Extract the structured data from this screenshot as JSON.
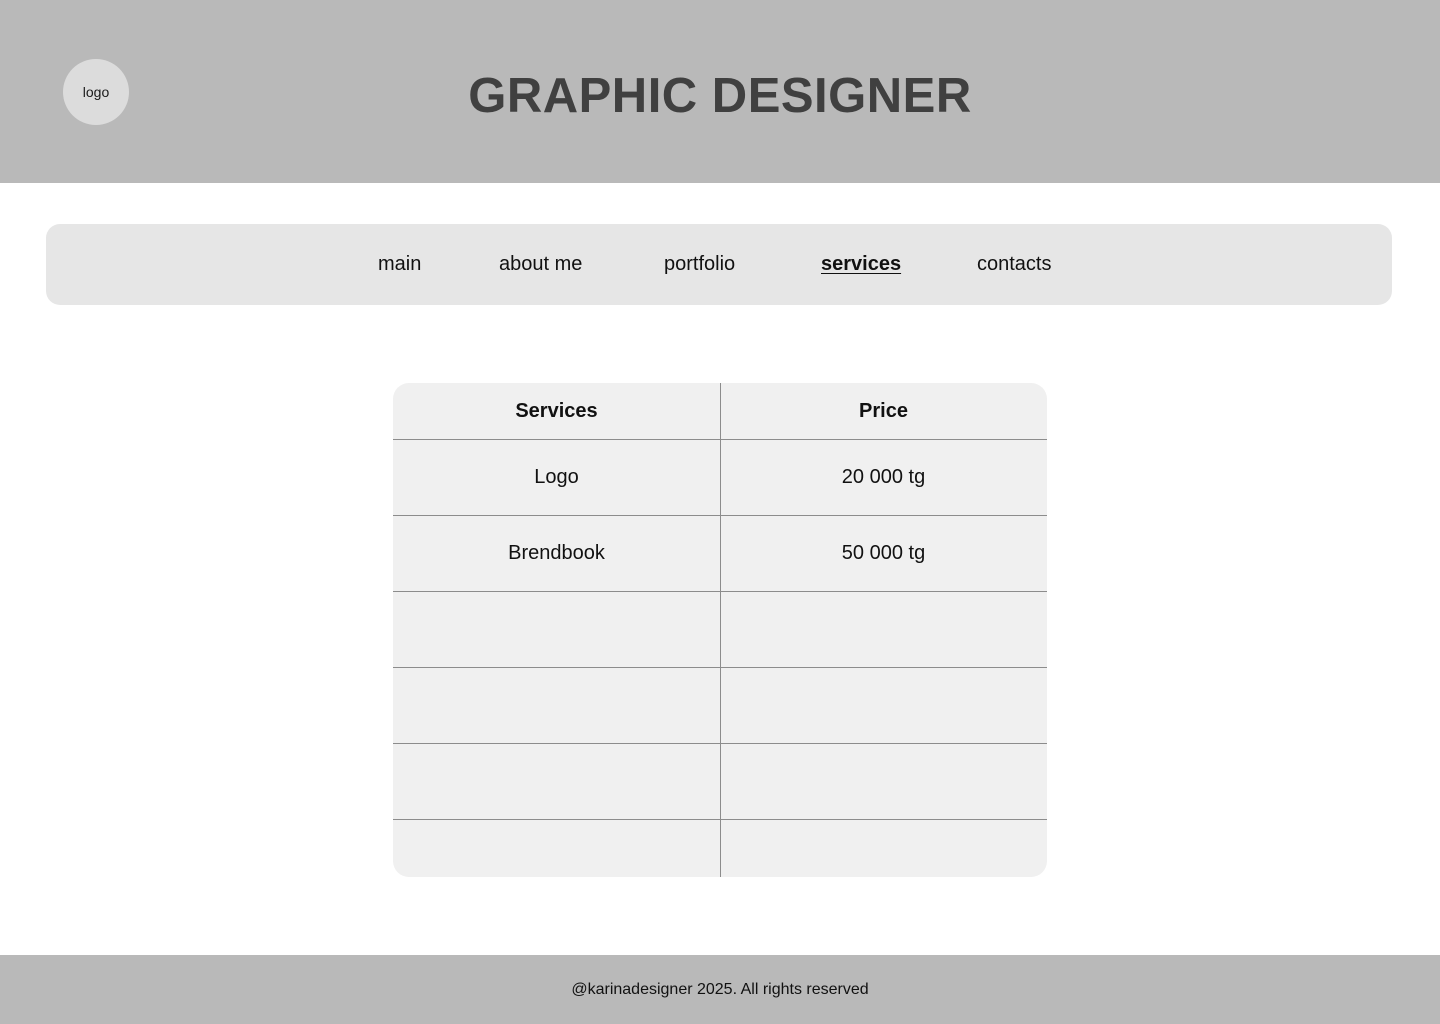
{
  "header": {
    "logo_label": "logo",
    "title": "GRAPHIC DESIGNER"
  },
  "nav": {
    "items": [
      {
        "label": "main",
        "active": false
      },
      {
        "label": "about me",
        "active": false
      },
      {
        "label": "portfolio",
        "active": false
      },
      {
        "label": "services",
        "active": true
      },
      {
        "label": "contacts",
        "active": false
      }
    ]
  },
  "services_table": {
    "headers": [
      "Services",
      "Price"
    ],
    "rows": [
      [
        "Logo",
        "20 000 tg"
      ],
      [
        "Brendbook",
        "50 000 tg"
      ],
      [
        "",
        ""
      ],
      [
        "",
        ""
      ],
      [
        "",
        ""
      ],
      [
        "",
        ""
      ]
    ]
  },
  "footer": {
    "text": "@karinadesigner 2025. All rights reserved"
  },
  "colors": {
    "header_bg": "#b9b9b9",
    "nav_bg": "#e6e6e6",
    "table_bg": "#f0f0f0",
    "title_color": "#404040"
  }
}
